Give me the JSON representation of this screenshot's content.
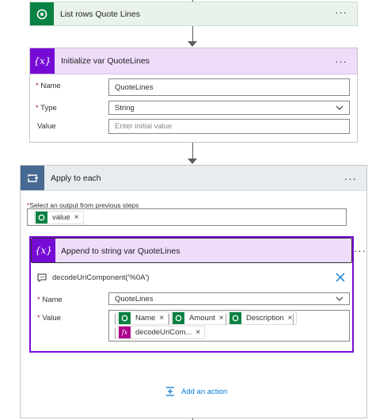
{
  "colors": {
    "dataverse_green": "#088142",
    "variable_purple": "#770bd6",
    "control_blue": "#486991",
    "expression_purple": "#ad008c",
    "accent_blue": "#0078d4"
  },
  "step_list_rows": {
    "title": "List rows Quote Lines",
    "icon": "dataverse-icon"
  },
  "step_init_var": {
    "title": "Initialize var QuoteLines",
    "icon": "variable-icon",
    "name_label": "Name",
    "name_value": "QuoteLines",
    "type_label": "Type",
    "type_value": "String",
    "value_label": "Value",
    "value_placeholder": "Enter initial value"
  },
  "apply_to_each": {
    "title": "Apply to each",
    "icon": "loop-icon",
    "select_label": "Select an output from previous steps",
    "token_value": "value",
    "add_action_label": "Add an action"
  },
  "append_step": {
    "title": "Append to string var QuoteLines",
    "icon": "variable-icon",
    "comment_text": "decodeUriComponent('%0A')",
    "name_label": "Name",
    "name_value": "QuoteLines",
    "value_label": "Value",
    "tokens": [
      "Name",
      "Amount",
      "Description"
    ],
    "expression_token": "decodeUriCom..."
  },
  "symbols": {
    "dots": "···",
    "required": "*",
    "remove": "×"
  }
}
